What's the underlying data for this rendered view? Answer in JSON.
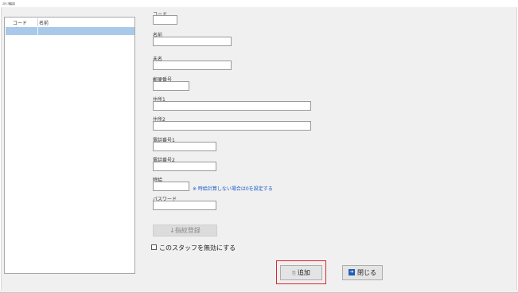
{
  "window": {
    "title": "ｽﾀｯﾌ編成"
  },
  "list": {
    "columns": [
      "コード",
      "名前"
    ],
    "rows": [
      {
        "code": "",
        "name": ""
      }
    ]
  },
  "form": {
    "code": {
      "label": "コード",
      "value": ""
    },
    "name": {
      "label": "名前",
      "value": ""
    },
    "kana": {
      "label": "未名",
      "value": ""
    },
    "postal": {
      "label": "郵便番号",
      "value": ""
    },
    "address1": {
      "label": "住所1",
      "value": ""
    },
    "address2": {
      "label": "住所2",
      "value": ""
    },
    "phone1": {
      "label": "電話番号1",
      "value": ""
    },
    "phone2": {
      "label": "電話番号2",
      "value": ""
    },
    "wage": {
      "label": "時給",
      "value": "",
      "hint": "※ 時給計算しない場合は0を設定する"
    },
    "password": {
      "label": "パスワード",
      "value": ""
    }
  },
  "buttons": {
    "fingerprint": "↓指紋登録",
    "add": "追加",
    "close": "閉じる"
  },
  "disable_checkbox": {
    "label": "このスタッフを無効にする",
    "checked": false
  }
}
